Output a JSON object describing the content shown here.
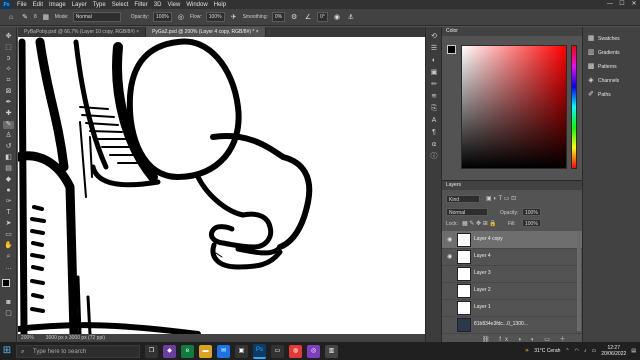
{
  "menubar": {
    "app_badge": "Ps",
    "items": [
      "File",
      "Edit",
      "Image",
      "Layer",
      "Type",
      "Select",
      "Filter",
      "3D",
      "View",
      "Window",
      "Help"
    ],
    "window_controls": {
      "minimize": "—",
      "maximize": "☐",
      "close": "✕"
    }
  },
  "options": {
    "mode_label": "Mode:",
    "mode_value": "Normal",
    "opacity_label": "Opacity:",
    "opacity_value": "100%",
    "flow_label": "Flow:",
    "flow_value": "100%",
    "smoothing_label": "Smoothing:",
    "smoothing_value": "0%",
    "angle_value": "0°",
    "brush_size": "8"
  },
  "tabs": [
    {
      "label": "PyBaPoby.psd @ 66,7% (Layer 10 copy, RGB/8#) ×",
      "active": false
    },
    {
      "label": "PyGa2.psd @ 200% (Layer 4 copy, RGB/8#) * ×",
      "active": true
    }
  ],
  "statusbar": {
    "zoom": "200%",
    "doc_info": "3000 px x 3000 px (72 ppi)"
  },
  "color_panel": {
    "title": "Color"
  },
  "layers_panel": {
    "title": "Layers",
    "filter_kind": "Kind",
    "blend_mode": "Normal",
    "opacity_label": "Opacity:",
    "opacity_value": "100%",
    "lock_label": "Lock:",
    "fill_label": "Fill:",
    "fill_value": "100%",
    "layers": [
      {
        "name": "Layer 4 copy",
        "visible": true,
        "selected": true
      },
      {
        "name": "Layer 4",
        "visible": true,
        "selected": false
      },
      {
        "name": "Layer 3",
        "visible": false,
        "selected": false
      },
      {
        "name": "Layer 2",
        "visible": false,
        "selected": false
      },
      {
        "name": "Layer 1",
        "visible": false,
        "selected": false
      },
      {
        "name": "81b834e3fdc...0_1300...",
        "visible": false,
        "selected": false
      }
    ]
  },
  "right_dock": {
    "items": [
      {
        "label": "Swatches",
        "icon": "swatches-icon"
      },
      {
        "label": "Gradients",
        "icon": "gradients-icon"
      },
      {
        "label": "Patterns",
        "icon": "patterns-icon"
      },
      {
        "label": "Channels",
        "icon": "channels-icon"
      },
      {
        "label": "Paths",
        "icon": "paths-icon"
      }
    ]
  },
  "taskbar": {
    "search_placeholder": "Type here to search",
    "weather": "31°C  Cerah",
    "time": "12:27",
    "date": "20/06/2022",
    "apps": [
      "task-view",
      "edge",
      "file-explorer",
      "mail",
      "store",
      "photoshop",
      "chrome",
      "app",
      "app",
      "app",
      "app"
    ]
  },
  "colors": {
    "accent": "#31a8ff",
    "panel_bg": "#535353",
    "toolbar_bg": "#424242",
    "menubar_bg": "#323232",
    "taskbar_bg": "#202020",
    "picker_hue": "#ff0000"
  }
}
